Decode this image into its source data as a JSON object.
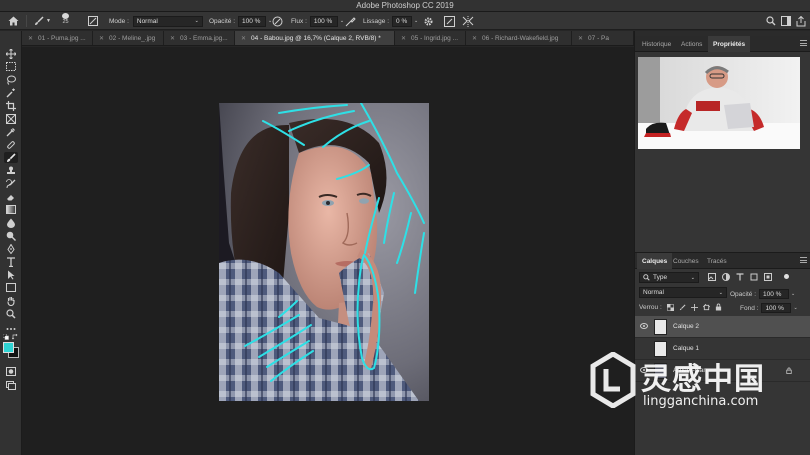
{
  "app_title": "Adobe Photoshop CC 2019",
  "options_bar": {
    "brush_size": "25",
    "mode_label": "Mode :",
    "mode_value": "Normal",
    "opacity_label": "Opacité :",
    "opacity_value": "100 %",
    "flow_label": "Flux :",
    "flow_value": "100 %",
    "smoothing_label": "Lissage :",
    "smoothing_value": "0 %"
  },
  "tabs": [
    {
      "label": "01 - Puma.jpg ..."
    },
    {
      "label": "02 - Meline_.jpg"
    },
    {
      "label": "03 - Emma.jpg..."
    },
    {
      "label": "04 - Babou.jpg @ 16,7% (Calque 2, RVB/8) *"
    },
    {
      "label": "05 - Ingrid.jpg ..."
    },
    {
      "label": "06 - Richard-Wakefield.jpg"
    },
    {
      "label": "07 - Pa"
    }
  ],
  "top_panel_tabs": [
    {
      "label": "Historique"
    },
    {
      "label": "Actions"
    },
    {
      "label": "Propriétés"
    }
  ],
  "layers_panel": {
    "tabs": [
      {
        "label": "Calques"
      },
      {
        "label": "Couches"
      },
      {
        "label": "Tracés"
      }
    ],
    "filter_value": "Type",
    "blend_mode": "Normal",
    "opacity_label": "Opacité :",
    "opacity_value": "100 %",
    "lock_label": "Verrou :",
    "fill_label": "Fond :",
    "fill_value": "100 %",
    "layers": [
      {
        "name": "Calque 2"
      },
      {
        "name": "Calque 1"
      },
      {
        "name": "Arrière-plan"
      }
    ]
  },
  "watermark": {
    "text_cn": "灵感中国",
    "url": "lingganchina.com"
  },
  "colors": {
    "foreground": "#2fd3d3",
    "background": "#111111",
    "stroke": "#2ee0e6"
  }
}
